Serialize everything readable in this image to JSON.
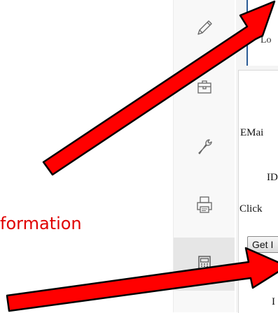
{
  "annotation": {
    "text": "formation"
  },
  "toolbar": {
    "items": [
      {
        "icon": "pencil-icon"
      },
      {
        "icon": "toolbox-icon"
      },
      {
        "icon": "wrench-icon"
      },
      {
        "icon": "printer-icon"
      },
      {
        "icon": "calculator-icon",
        "active": true
      }
    ]
  },
  "tab": {
    "label": "Lo"
  },
  "form": {
    "email_label": "EMai",
    "id_label": "ID",
    "click_text": "Click",
    "get_button": "Get I",
    "bottom_label": "I"
  },
  "colors": {
    "arrow": "#ff0000",
    "annotation": "#e00000",
    "tab_accent": "#2b5c96"
  }
}
